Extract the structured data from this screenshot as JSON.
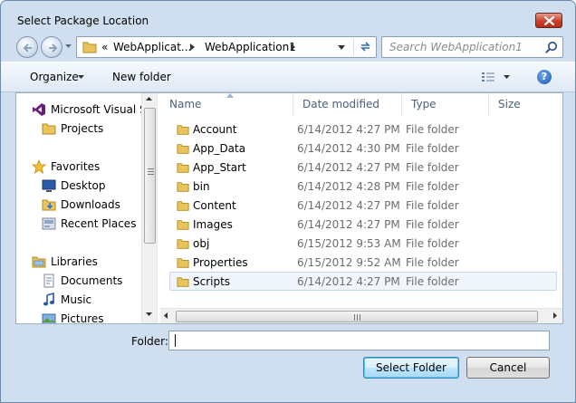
{
  "window": {
    "title": "Select Package Location"
  },
  "address_bar": {
    "chevron": "«",
    "segments": [
      "WebApplicat...",
      "WebApplication1"
    ]
  },
  "search": {
    "placeholder": "Search WebApplication1"
  },
  "toolbar": {
    "organize_label": "Organize",
    "new_folder_label": "New folder",
    "help_glyph": "?"
  },
  "nav_pane": {
    "items": [
      {
        "label": "Microsoft Visual St",
        "icon": "visual-studio-icon",
        "level": 0
      },
      {
        "label": "Projects",
        "icon": "folder-icon",
        "level": 1
      },
      {
        "label": "Favorites",
        "icon": "star-icon",
        "level": 0
      },
      {
        "label": "Desktop",
        "icon": "desktop-icon",
        "level": 1
      },
      {
        "label": "Downloads",
        "icon": "downloads-icon",
        "level": 1
      },
      {
        "label": "Recent Places",
        "icon": "recent-places-icon",
        "level": 1
      },
      {
        "label": "Libraries",
        "icon": "libraries-icon",
        "level": 0
      },
      {
        "label": "Documents",
        "icon": "documents-icon",
        "level": 1
      },
      {
        "label": "Music",
        "icon": "music-icon",
        "level": 1
      },
      {
        "label": "Pictures",
        "icon": "pictures-icon",
        "level": 1
      }
    ]
  },
  "file_list": {
    "columns": [
      "Name",
      "Date modified",
      "Type",
      "Size"
    ],
    "rows": [
      {
        "name": "Account",
        "date": "6/14/2012 4:27 PM",
        "type": "File folder",
        "selected": false
      },
      {
        "name": "App_Data",
        "date": "6/14/2012 4:30 PM",
        "type": "File folder",
        "selected": false
      },
      {
        "name": "App_Start",
        "date": "6/14/2012 4:27 PM",
        "type": "File folder",
        "selected": false
      },
      {
        "name": "bin",
        "date": "6/14/2012 4:28 PM",
        "type": "File folder",
        "selected": false
      },
      {
        "name": "Content",
        "date": "6/14/2012 4:27 PM",
        "type": "File folder",
        "selected": false
      },
      {
        "name": "Images",
        "date": "6/14/2012 4:27 PM",
        "type": "File folder",
        "selected": false
      },
      {
        "name": "obj",
        "date": "6/15/2012 9:53 AM",
        "type": "File folder",
        "selected": false
      },
      {
        "name": "Properties",
        "date": "6/15/2012 9:52 AM",
        "type": "File folder",
        "selected": false
      },
      {
        "name": "Scripts",
        "date": "6/14/2012 4:27 PM",
        "type": "File folder",
        "selected": true
      }
    ]
  },
  "footer": {
    "folder_label": "Folder:",
    "folder_value": "",
    "select_button": "Select Folder",
    "cancel_button": "Cancel"
  },
  "colors": {
    "chrome": "#cfdff0",
    "selection_bg": "#f1f6fc",
    "selection_border": "#c4d6ec",
    "folder_yellow": "#e8c45a",
    "column_text": "#4c607a"
  }
}
